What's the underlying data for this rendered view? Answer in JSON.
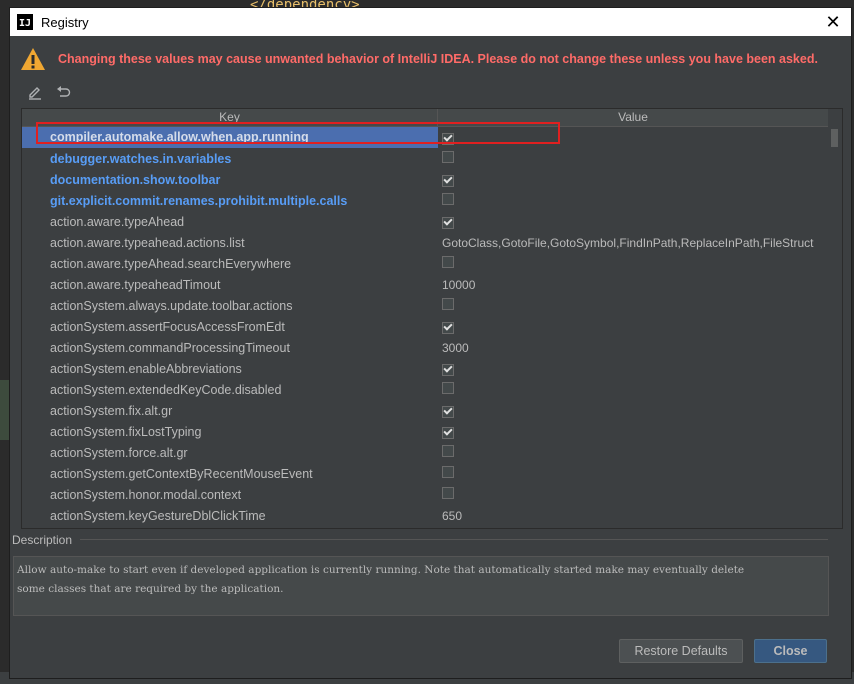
{
  "background": {
    "editor_snippet": "</dependency>"
  },
  "window": {
    "title": "Registry",
    "logo_text": "IJ",
    "close_glyph": "✕"
  },
  "warning": {
    "text": "Changing these values may cause unwanted behavior of IntelliJ IDEA. Please do not change these unless you have been asked.",
    "color": "#ff6b68"
  },
  "toolbar": {
    "edit_icon": "pencil-icon",
    "revert_icon": "undo-icon"
  },
  "table": {
    "columns": [
      "Key",
      "Value"
    ],
    "rows": [
      {
        "key": "compiler.automake.allow.when.app.running",
        "type": "bool",
        "checked": true,
        "modified": true,
        "selected": true
      },
      {
        "key": "debugger.watches.in.variables",
        "type": "bool",
        "checked": false,
        "modified": true
      },
      {
        "key": "documentation.show.toolbar",
        "type": "bool",
        "checked": true,
        "modified": true
      },
      {
        "key": "git.explicit.commit.renames.prohibit.multiple.calls",
        "type": "bool",
        "checked": false,
        "modified": true
      },
      {
        "key": "action.aware.typeAhead",
        "type": "bool",
        "checked": true
      },
      {
        "key": "action.aware.typeahead.actions.list",
        "type": "text",
        "value": "GotoClass,GotoFile,GotoSymbol,FindInPath,ReplaceInPath,FileStruct"
      },
      {
        "key": "action.aware.typeAhead.searchEverywhere",
        "type": "bool",
        "checked": false
      },
      {
        "key": "action.aware.typeaheadTimout",
        "type": "text",
        "value": "10000"
      },
      {
        "key": "actionSystem.always.update.toolbar.actions",
        "type": "bool",
        "checked": false
      },
      {
        "key": "actionSystem.assertFocusAccessFromEdt",
        "type": "bool",
        "checked": true
      },
      {
        "key": "actionSystem.commandProcessingTimeout",
        "type": "text",
        "value": "3000"
      },
      {
        "key": "actionSystem.enableAbbreviations",
        "type": "bool",
        "checked": true
      },
      {
        "key": "actionSystem.extendedKeyCode.disabled",
        "type": "bool",
        "checked": false
      },
      {
        "key": "actionSystem.fix.alt.gr",
        "type": "bool",
        "checked": true
      },
      {
        "key": "actionSystem.fixLostTyping",
        "type": "bool",
        "checked": true
      },
      {
        "key": "actionSystem.force.alt.gr",
        "type": "bool",
        "checked": false
      },
      {
        "key": "actionSystem.getContextByRecentMouseEvent",
        "type": "bool",
        "checked": false
      },
      {
        "key": "actionSystem.honor.modal.context",
        "type": "bool",
        "checked": false
      },
      {
        "key": "actionSystem.keyGestureDblClickTime",
        "type": "text",
        "value": "650"
      }
    ]
  },
  "description": {
    "label": "Description",
    "lines": [
      "Allow auto-make to start even if developed application is currently running. Note that automatically started make may eventually delete",
      "some classes that are required by the application."
    ]
  },
  "buttons": {
    "restore": "Restore Defaults",
    "close": "Close"
  },
  "colors": {
    "modified_key": "#589df6",
    "selection": "#4b6eaf",
    "highlight_border": "#e02020",
    "primary_button": "#365880"
  }
}
